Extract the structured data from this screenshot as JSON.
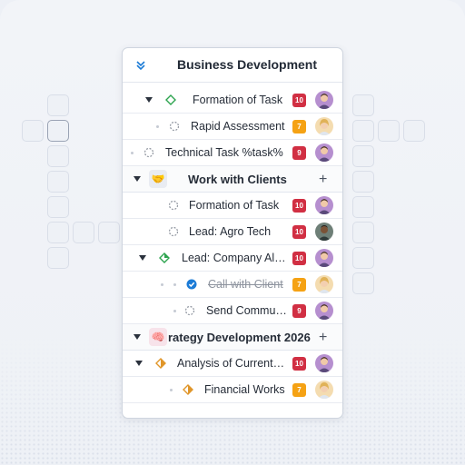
{
  "panel": {
    "title": "Business Development",
    "collapse_icon": "double-chevron-down-icon"
  },
  "rows": [
    {
      "label": "Formation of Task",
      "badge": "10",
      "badge_color": "#d12f43",
      "status_icon": "diamond-outline-green-icon"
    },
    {
      "label": "Rapid Assessment",
      "badge": "7",
      "badge_color": "#f5a214",
      "status_icon": "dashed-circle-icon"
    },
    {
      "label": "Technical Task %task%",
      "badge": "9",
      "badge_color": "#d12f43",
      "status_icon": "dashed-circle-icon"
    }
  ],
  "group1": {
    "label": "Work with Clients",
    "icon": "handshake-icon",
    "rows": [
      {
        "label": "Formation of Task",
        "badge": "10",
        "status_icon": "dashed-circle-icon"
      },
      {
        "label": "Lead: Agro Tech",
        "badge": "10",
        "status_icon": "dashed-circle-icon"
      },
      {
        "label": "Lead: Company Al…",
        "badge": "10",
        "status_icon": "diamond-green-icon"
      },
      {
        "label": "Call with Client",
        "badge": "7",
        "status_icon": "check-blue-icon"
      },
      {
        "label": "Send Commu…",
        "badge": "9",
        "status_icon": "dashed-circle-icon"
      }
    ]
  },
  "group2": {
    "label": "rategy Development 2026",
    "icon": "brain-icon",
    "rows": [
      {
        "label": "Analysis of Current…",
        "badge": "10",
        "status_icon": "diamond-orange-icon"
      },
      {
        "label": "Financial Works",
        "badge": "7",
        "status_icon": "diamond-orange-icon"
      }
    ]
  },
  "colors": {
    "badge_red": "#d12f43",
    "badge_orange": "#f5a214",
    "accent_blue": "#1b7bd6",
    "status_green": "#2ea44f"
  }
}
